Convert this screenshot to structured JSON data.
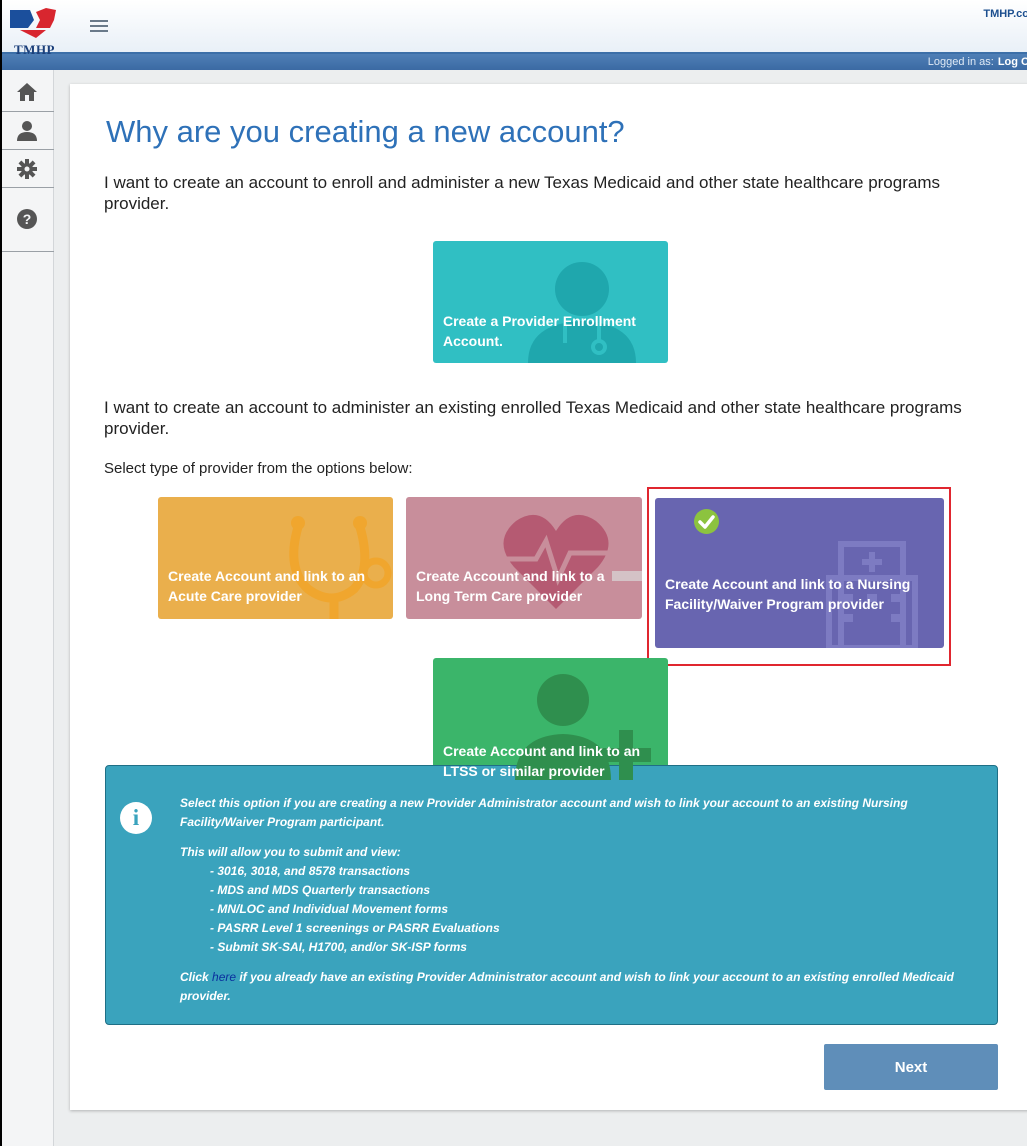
{
  "header": {
    "logo_text": "TMHP",
    "top_link": "TMHP.co",
    "logged_in_label": "Logged in as:",
    "logout_label": "Log C"
  },
  "rail": {
    "items": [
      {
        "icon": "home-icon"
      },
      {
        "icon": "user-icon"
      },
      {
        "icon": "gear-icon"
      },
      {
        "icon": "help-icon"
      }
    ]
  },
  "main": {
    "title": "Why are you creating a new account?",
    "intro_new": "I want to create an account to enroll and administer a new Texas Medicaid and other state healthcare programs provider.",
    "intro_existing": "I want to create an account to administer an existing enrolled Texas Medicaid and other state healthcare programs provider.",
    "select_prompt": "Select type of provider from the options below:",
    "tiles": {
      "enroll": "Create a Provider Enrollment Account.",
      "acute": "Create Account and link to an Acute Care provider",
      "ltc": "Create Account and link to a Long Term Care provider",
      "nf": "Create Account and link to a Nursing Facility/Waiver Program provider",
      "ltss": "Create Account and link to an LTSS or similar provider"
    },
    "selected_tile": "nf",
    "info": {
      "line1": "Select this option if you are creating a new Provider Administrator account and wish to link your account to an existing Nursing Facility/Waiver Program participant.",
      "line2": "This will allow you to submit and view:",
      "items": [
        "- 3016, 3018, and 8578 transactions",
        "- MDS and MDS Quarterly transactions",
        "- MN/LOC and Individual Movement forms",
        "- PASRR Level 1 screenings or PASRR Evaluations",
        "- Submit SK-SAI, H1700, and/or SK-ISP forms"
      ],
      "click_prefix": "Click",
      "here_link": "here",
      "click_suffix": "if you already have an existing Provider Administrator account and wish to link your account to an existing enrolled Medicaid provider."
    },
    "next_label": "Next"
  },
  "colors": {
    "title_blue": "#2e71b8",
    "tile_enroll": "#30bfc3",
    "tile_acute": "#eaaf4c",
    "tile_ltc": "#c88e9b",
    "tile_nf": "#6865b0",
    "tile_ltss": "#3bb56a",
    "info_bg": "#3aa3bd",
    "next_button": "#5f8eb9",
    "selection_border": "#e0262f"
  }
}
